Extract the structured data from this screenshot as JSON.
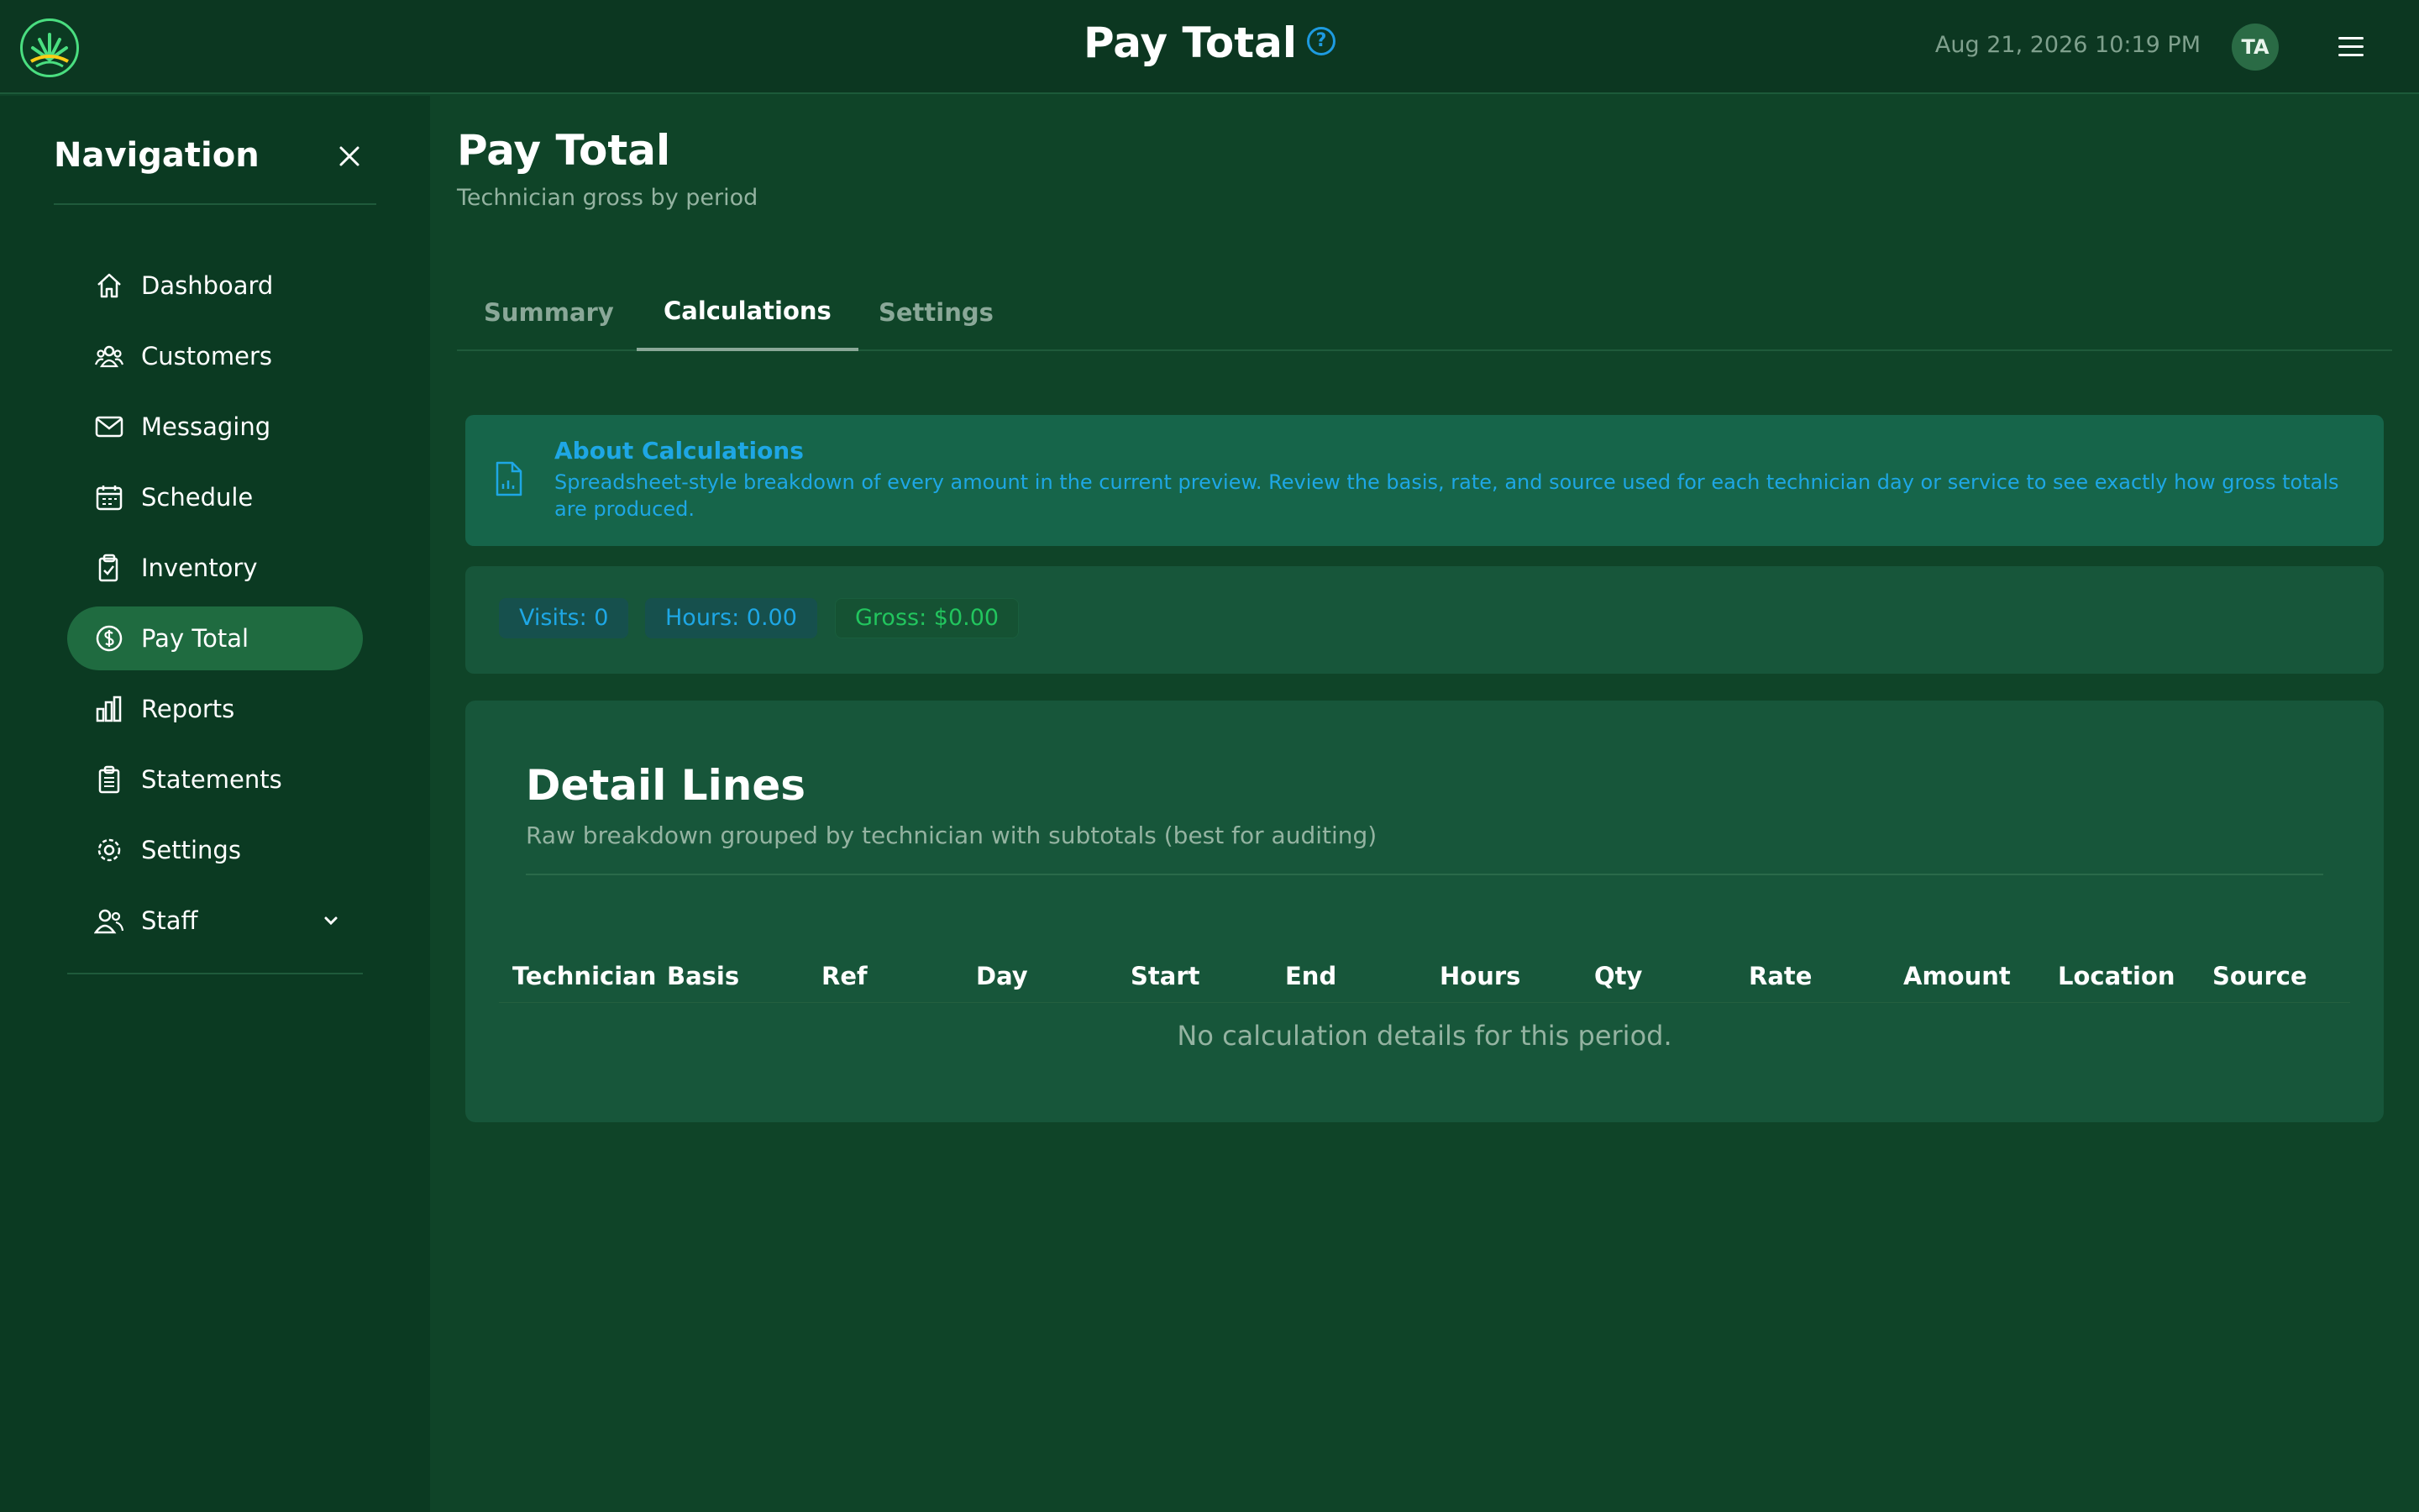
{
  "header": {
    "title": "Pay Total",
    "datetime": "Aug 21, 2026 10:19 PM",
    "avatar_initials": "TA",
    "help_icon": "?"
  },
  "sidebar": {
    "title": "Navigation",
    "items": [
      {
        "label": "Dashboard",
        "icon": "home-icon"
      },
      {
        "label": "Customers",
        "icon": "users-icon"
      },
      {
        "label": "Messaging",
        "icon": "mail-icon"
      },
      {
        "label": "Schedule",
        "icon": "calendar-icon"
      },
      {
        "label": "Inventory",
        "icon": "clipboard-check-icon"
      },
      {
        "label": "Pay Total",
        "icon": "dollar-circle-icon",
        "active": true
      },
      {
        "label": "Reports",
        "icon": "bar-chart-icon"
      },
      {
        "label": "Statements",
        "icon": "document-list-icon"
      },
      {
        "label": "Settings",
        "icon": "gear-icon"
      },
      {
        "label": "Staff",
        "icon": "staff-icon",
        "expandable": true
      }
    ]
  },
  "page": {
    "title": "Pay Total",
    "subtitle": "Technician gross by period",
    "tabs": [
      "Summary",
      "Calculations",
      "Settings"
    ],
    "active_tab": "Calculations"
  },
  "about": {
    "title": "About Calculations",
    "text": "Spreadsheet-style breakdown of every amount in the current preview. Review the basis, rate, and source used for each technician day or service to see exactly how gross totals are produced."
  },
  "stats": {
    "visits": "Visits: 0",
    "hours": "Hours: 0.00",
    "gross": "Gross: $0.00"
  },
  "detail": {
    "title": "Detail Lines",
    "subtitle": "Raw breakdown grouped by technician with subtotals (best for auditing)",
    "columns": [
      "Technician",
      "Basis",
      "Ref",
      "Day",
      "Start",
      "End",
      "Hours",
      "Qty",
      "Rate",
      "Amount",
      "Location",
      "Source"
    ],
    "empty_message": "No calculation details for this period."
  },
  "colors": {
    "accent_blue": "#1ea7e5",
    "accent_green": "#22c55e",
    "active_nav": "#1f6b40"
  }
}
